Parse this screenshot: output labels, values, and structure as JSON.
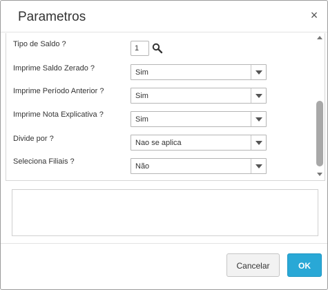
{
  "dialog": {
    "title": "Parametros",
    "close_symbol": "×"
  },
  "params": {
    "tipo_saldo": {
      "label": "Tipo de Saldo ?",
      "value": "1"
    },
    "imprime_saldo_zerado": {
      "label": "Imprime Saldo Zerado ?",
      "value": "Sim"
    },
    "imprime_periodo_anterior": {
      "label": "Imprime Período Anterior ?",
      "value": "Sim"
    },
    "imprime_nota_explicativa": {
      "label": "Imprime Nota Explicativa ?",
      "value": "Sim"
    },
    "divide_por": {
      "label": "Divide por ?",
      "value": "Nao se aplica"
    },
    "seleciona_filiais": {
      "label": "Seleciona Filiais ?",
      "value": "Não"
    }
  },
  "footer": {
    "cancel_label": "Cancelar",
    "ok_label": "OK"
  },
  "icons": {
    "search": "search-icon",
    "close": "close-icon",
    "dropdown": "chevron-down-icon"
  },
  "colors": {
    "primary_button": "#29a8d6",
    "scroll_thumb": "#a8a8a8"
  }
}
